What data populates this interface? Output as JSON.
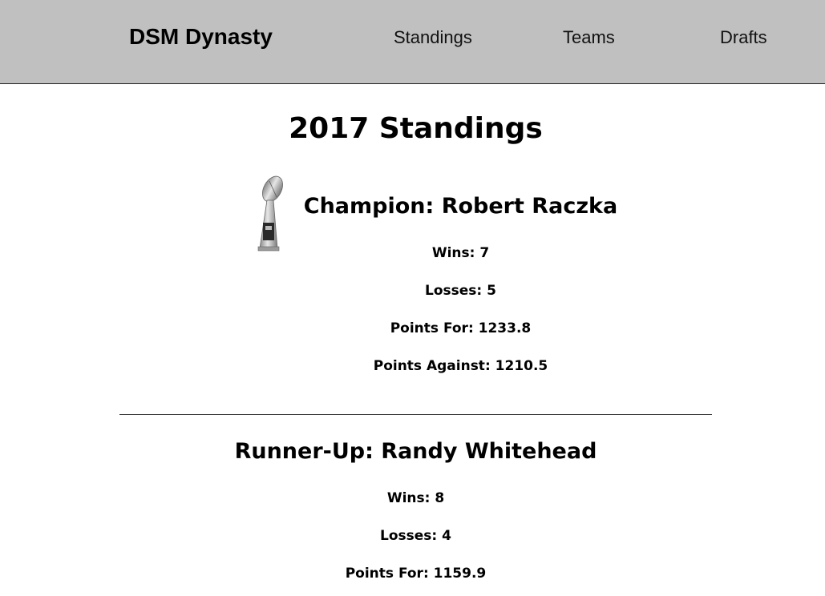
{
  "nav": {
    "brand": "DSM Dynasty",
    "links": [
      "Standings",
      "Teams",
      "Drafts"
    ]
  },
  "page": {
    "title": "2017 Standings"
  },
  "champion": {
    "heading": "Champion: Robert Raczka",
    "icon": "trophy-icon",
    "stats": [
      "Wins: 7",
      "Losses: 5",
      "Points For: 1233.8",
      "Points Against: 1210.5"
    ]
  },
  "runner_up": {
    "heading": "Runner-Up: Randy Whitehead",
    "stats": [
      "Wins: 8",
      "Losses: 4",
      "Points For: 1159.9"
    ]
  },
  "colors": {
    "navbar_bg": "#c0c0c0",
    "text": "#000000"
  }
}
